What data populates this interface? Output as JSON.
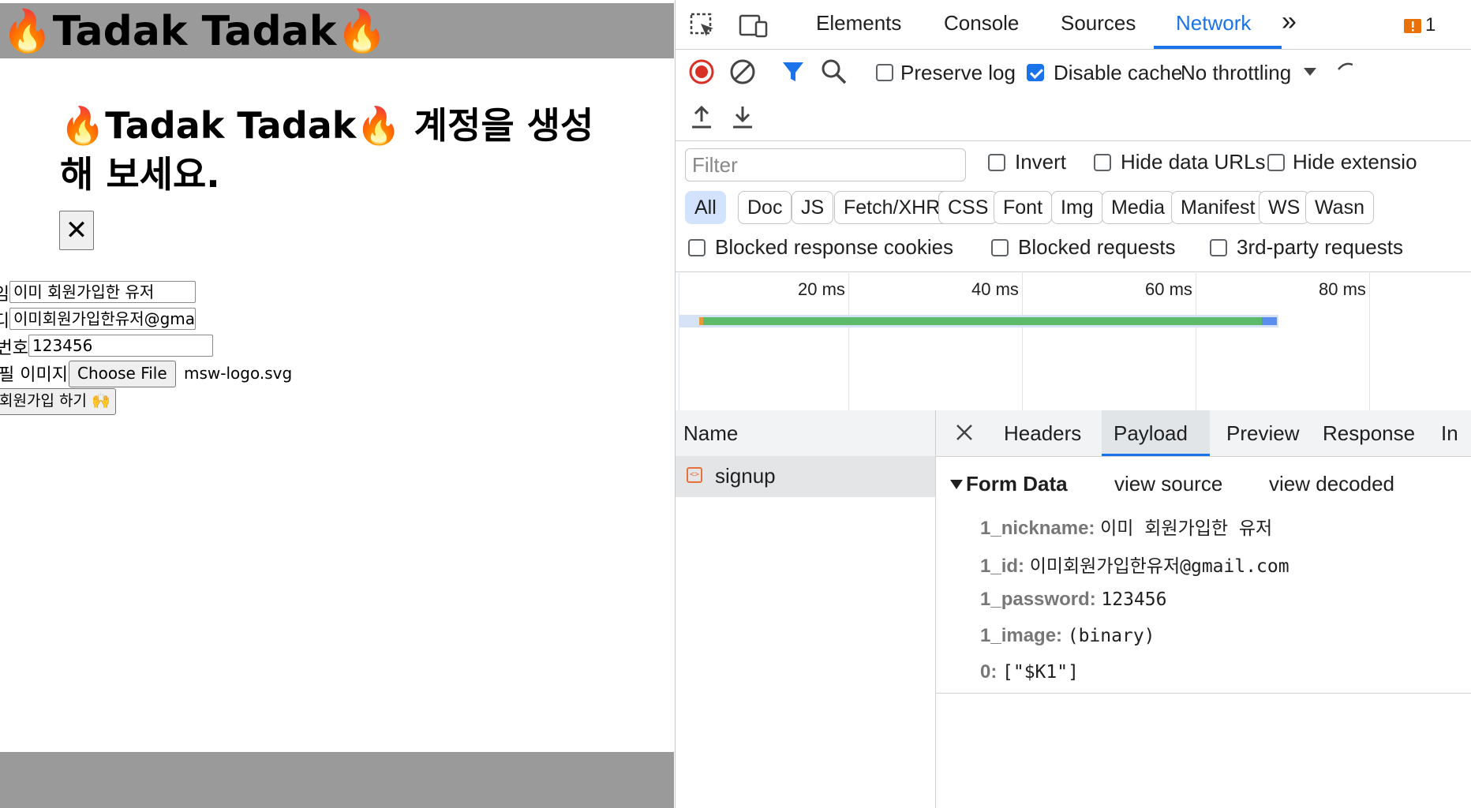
{
  "site": {
    "title": "🔥Tadak Tadak🔥",
    "modal_title": "🔥Tadak Tadak🔥 계정을 생성해 보세요.",
    "close_label": "✕",
    "form": {
      "nickname_label": "닉네임",
      "nickname_value": "이미 회원가입한 유저",
      "id_label": "아이디",
      "id_value": "이미회원가입한유저@gma",
      "password_label": "비밀번호",
      "password_value": "123456",
      "image_label": "프로필 이미지",
      "file_button": "Choose File",
      "file_name": "msw-logo.svg",
      "submit_label": "회원가입 하기 🙌"
    }
  },
  "devtools": {
    "tabs": [
      "Elements",
      "Console",
      "Sources",
      "Network"
    ],
    "active_tab": "Network",
    "more_tabs": "»",
    "issue_count": "1",
    "toolbar": {
      "preserve_log": "Preserve log",
      "disable_cache": "Disable cache",
      "throttling": "No throttling"
    },
    "filter": {
      "placeholder": "Filter",
      "invert": "Invert",
      "hide_data_urls": "Hide data URLs",
      "hide_extensions": "Hide extensio",
      "chips": [
        "All",
        "Doc",
        "JS",
        "Fetch/XHR",
        "CSS",
        "Font",
        "Img",
        "Media",
        "Manifest",
        "WS",
        "Wasn"
      ],
      "blocked_cookies": "Blocked response cookies",
      "blocked_requests": "Blocked requests",
      "third_party": "3rd-party requests"
    },
    "timeline": {
      "ticks": [
        "20 ms",
        "40 ms",
        "60 ms",
        "80 ms"
      ]
    },
    "requests": {
      "header": "Name",
      "items": [
        "signup"
      ]
    },
    "detail": {
      "tabs": [
        "Headers",
        "Payload",
        "Preview",
        "Response",
        "In"
      ],
      "active_tab": "Payload",
      "section_title": "Form Data",
      "view_source": "view source",
      "view_decoded": "view decoded",
      "rows": [
        {
          "key": "1_nickname:",
          "value": "이미 회원가입한 유저"
        },
        {
          "key": "1_id:",
          "value": "이미회원가입한유저@gmail.com"
        },
        {
          "key": "1_password:",
          "value": "123456"
        },
        {
          "key": "1_image:",
          "value": "(binary)"
        },
        {
          "key": "0:",
          "value": "[\"$K1\"]"
        }
      ]
    },
    "colors": {
      "accent": "#1a73e8",
      "record": "#d93025",
      "warning": "#e8710a"
    }
  }
}
